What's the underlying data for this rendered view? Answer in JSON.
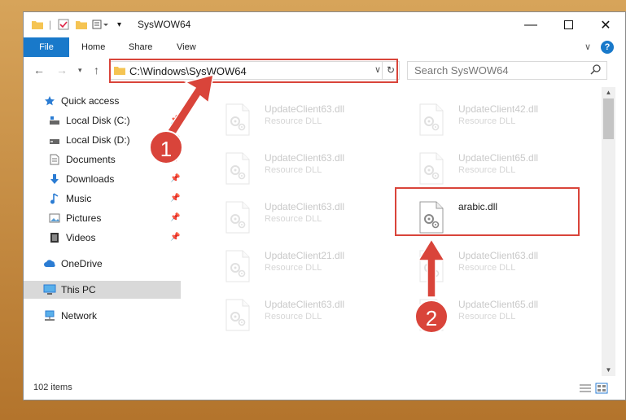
{
  "window": {
    "title": "SysWOW64"
  },
  "ribbon": {
    "tabs": [
      "File",
      "Home",
      "Share",
      "View"
    ]
  },
  "address": {
    "path": "C:\\Windows\\SysWOW64"
  },
  "search": {
    "placeholder": "Search SysWOW64"
  },
  "sidebar": {
    "items": [
      {
        "label": "Quick access",
        "icon": "star-icon"
      },
      {
        "label": "Local Disk (C:)",
        "icon": "drive-icon"
      },
      {
        "label": "Local Disk (D:)",
        "icon": "drive-icon"
      },
      {
        "label": "Documents",
        "icon": "documents-icon"
      },
      {
        "label": "Downloads",
        "icon": "download-icon"
      },
      {
        "label": "Music",
        "icon": "music-icon"
      },
      {
        "label": "Pictures",
        "icon": "pictures-icon"
      },
      {
        "label": "Videos",
        "icon": "videos-icon"
      },
      {
        "label": "OneDrive",
        "icon": "cloud-icon"
      },
      {
        "label": "This PC",
        "icon": "computer-icon"
      },
      {
        "label": "Network",
        "icon": "network-icon"
      }
    ]
  },
  "files": [
    {
      "name": "UpdateClient63.dll",
      "type": "Resource DLL"
    },
    {
      "name": "UpdateClient42.dll",
      "type": "Resource DLL"
    },
    {
      "name": "UpdateClient63.dll",
      "type": "Resource DLL"
    },
    {
      "name": "UpdateClient65.dll",
      "type": "Resource DLL"
    },
    {
      "name": "UpdateClient63.dll",
      "type": "Resource DLL"
    },
    {
      "name": "arabic.dll",
      "type": ""
    },
    {
      "name": "UpdateClient21.dll",
      "type": "Resource DLL"
    },
    {
      "name": "UpdateClient63.dll",
      "type": "Resource DLL"
    },
    {
      "name": "UpdateClient63.dll",
      "type": "Resource DLL"
    },
    {
      "name": "UpdateClient65.dll",
      "type": "Resource DLL"
    }
  ],
  "status": {
    "count": "102 items"
  },
  "annotations": {
    "step1": "1",
    "step2": "2",
    "color": "#d9443a"
  },
  "colors": {
    "accent": "#1979ca",
    "highlight": "#d9443a"
  }
}
